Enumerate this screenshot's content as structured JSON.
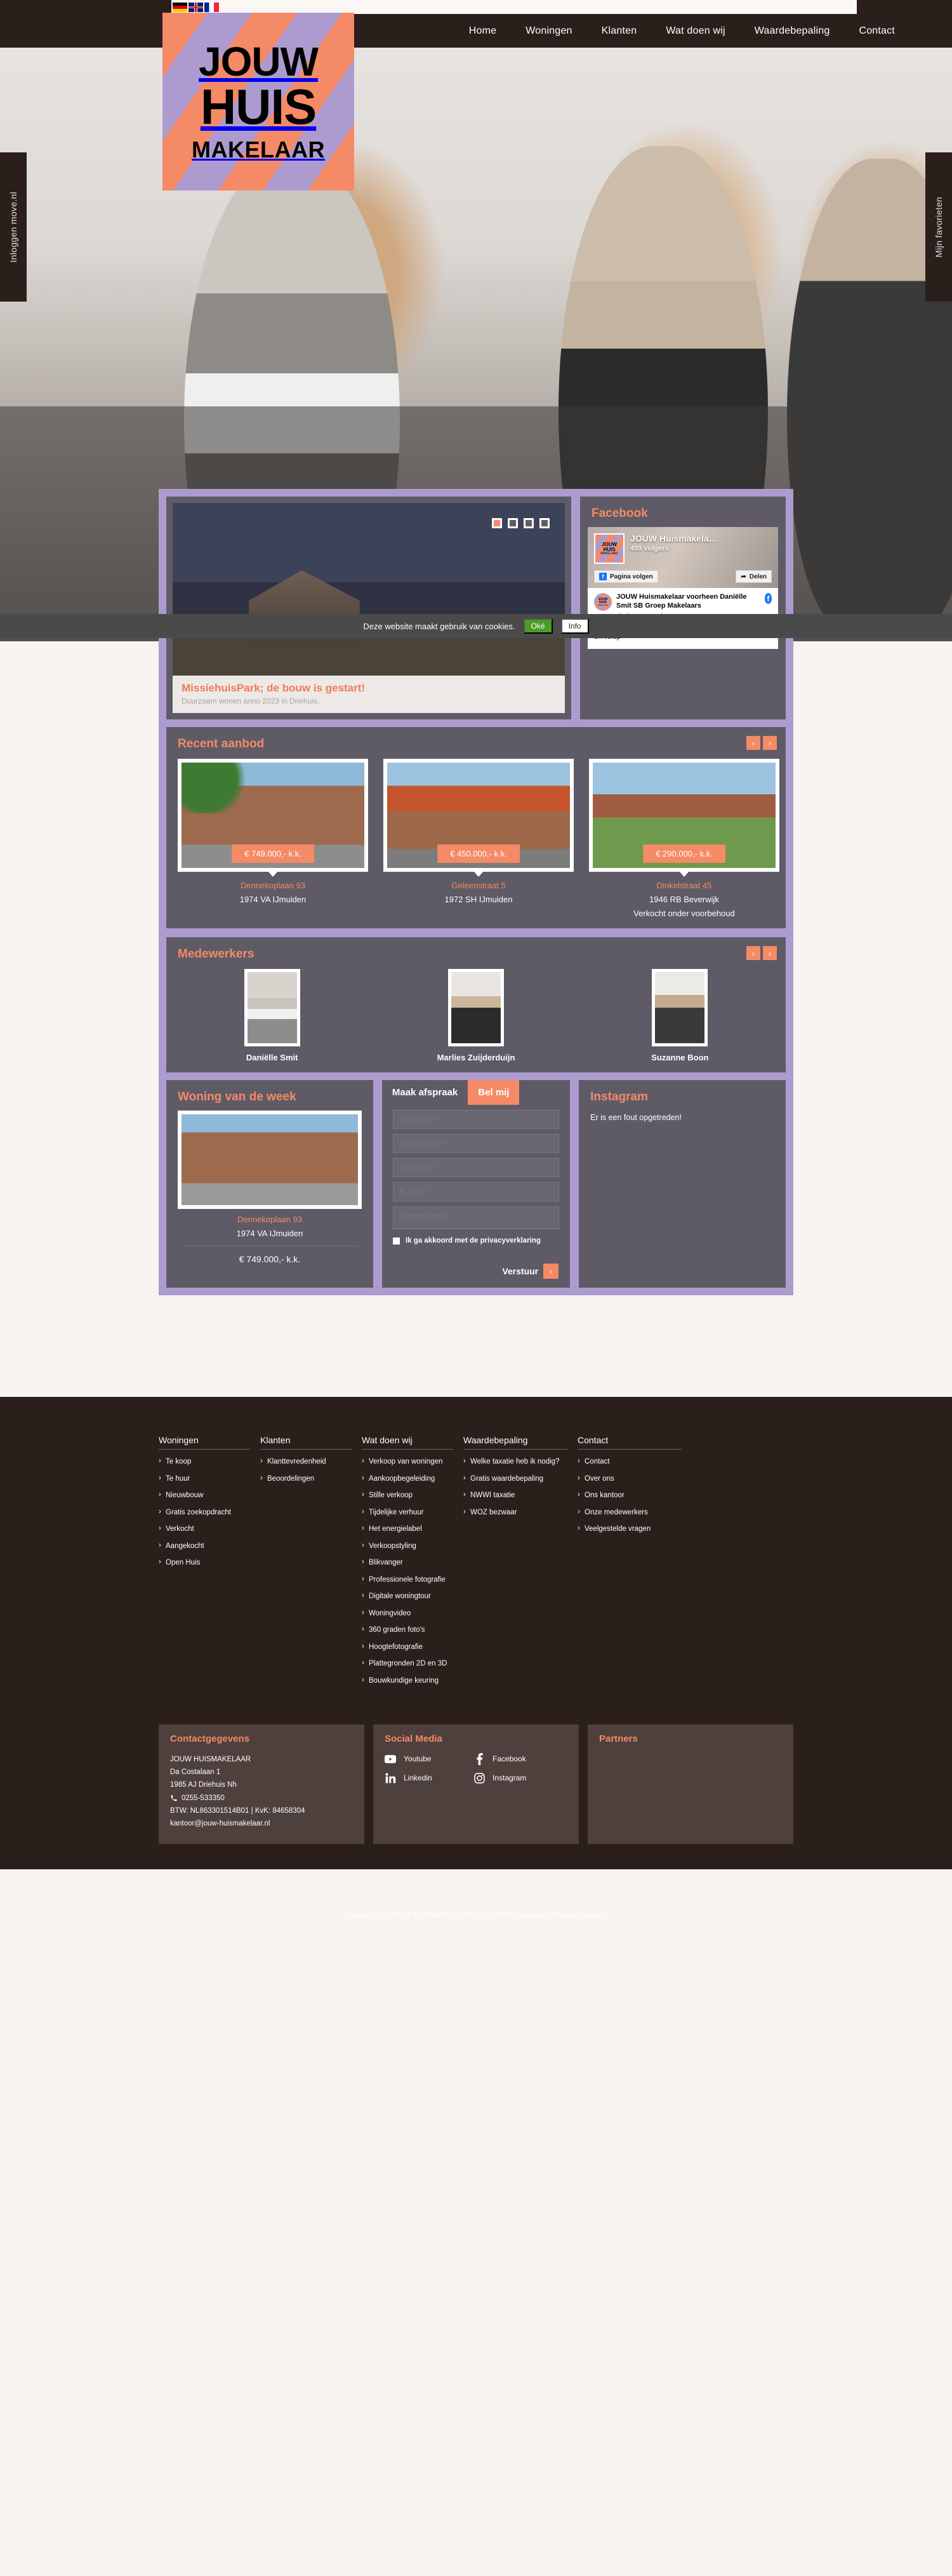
{
  "topbar": {
    "flags": [
      {
        "name": "flag-de",
        "label": "Deutsch"
      },
      {
        "name": "flag-gb",
        "label": "English"
      },
      {
        "name": "flag-fr",
        "label": "Français"
      }
    ],
    "nav": [
      {
        "label": "Home"
      },
      {
        "label": "Woningen"
      },
      {
        "label": "Klanten"
      },
      {
        "label": "Wat doen wij"
      },
      {
        "label": "Waardebepaling"
      },
      {
        "label": "Contact"
      }
    ]
  },
  "logo": {
    "line1": "JOUW",
    "line2": "HUIS",
    "line3": "MAKELAAR",
    "colors": {
      "orange": "#f58a66",
      "purple": "#ad9bd0"
    }
  },
  "side_tabs": {
    "left": "Inloggen move.nl",
    "right": "Mijn favorieten"
  },
  "cookie": {
    "message": "Deze website maakt gebruik van cookies.",
    "accept": "Oké",
    "info": "Info"
  },
  "slider": {
    "title": "MissiehuisPark; de bouw is gestart!",
    "subtitle": "Duurzaam wonen anno 2023 in Driehuis.",
    "dots": 4,
    "active_dot": 0
  },
  "facebook": {
    "panel_title": "Facebook",
    "page_name": "JOUW Huismakela…",
    "followers": "459 volgers",
    "avatar": {
      "l1": "JOUW",
      "l2": "HUIS",
      "l3": "MAKELAAR"
    },
    "follow_button": "Pagina volgen",
    "share_button": "Delen",
    "post": {
      "author": "JOUW Huismakelaar voorheen Daniëlle Smit SB Groep Makelaars",
      "time": "afgelopen woensdag",
      "body": "Royale, instapklare woning met een moderne uitstraling en volop"
    }
  },
  "recent": {
    "title": "Recent aanbod",
    "prev": "‹",
    "next": "›",
    "items": [
      {
        "price": "€ 749.000,- k.k.",
        "street": "Dennekoplaan 93",
        "city": "1974 VA IJmuiden",
        "status": ""
      },
      {
        "price": "€ 450.000,- k.k.",
        "street": "Geleenstraat 5",
        "city": "1972 SH IJmuiden",
        "status": ""
      },
      {
        "price": "€ 290.000,- k.k.",
        "street": "Dinkelstraat 45",
        "city": "1946 RB Beverwijk",
        "status": "Verkocht onder voorbehoud"
      }
    ]
  },
  "employees": {
    "title": "Medewerkers",
    "prev": "‹",
    "next": "›",
    "items": [
      {
        "name": "Daniëlle Smit"
      },
      {
        "name": "Marlies Zuijderduijn"
      },
      {
        "name": "Suzanne Boon"
      }
    ]
  },
  "week_house": {
    "title": "Woning van de week",
    "street": "Dennekoplaan 93",
    "city": "1974 VA IJmuiden",
    "price": "€ 749.000,- k.k."
  },
  "appointment": {
    "tab_active": "Maak afspraak",
    "tab_inactive": "Bel mij",
    "fields": [
      {
        "name": "voornaam",
        "placeholder": "Voornaam *",
        "value": ""
      },
      {
        "name": "achternaam",
        "placeholder": "Achternaam *",
        "value": ""
      },
      {
        "name": "telefoon",
        "placeholder": "Telefoon *",
        "value": ""
      },
      {
        "name": "email",
        "placeholder": "E-mail *",
        "value": ""
      }
    ],
    "textarea": {
      "placeholder": "Opmerkingen",
      "value": ""
    },
    "privacy_label": "Ik ga akkoord met de privacyverklaring",
    "submit_label": "Verstuur",
    "submit_icon": "›"
  },
  "instagram": {
    "title": "Instagram",
    "error": "Er is een fout opgetreden!"
  },
  "footer": {
    "columns": [
      {
        "title": "Woningen",
        "links": [
          "Te koop",
          "Te huur",
          "Nieuwbouw",
          "Gratis zoekopdracht",
          "Verkocht",
          "Aangekocht",
          "Open Huis"
        ]
      },
      {
        "title": "Klanten",
        "links": [
          "Klanttevredenheid",
          "Beoordelingen"
        ]
      },
      {
        "title": "Wat doen wij",
        "links": [
          "Verkoop van woningen",
          "Aankoopbegeleiding",
          "Stille verkoop",
          "Tijdelijke verhuur",
          "Het energielabel",
          "Verkoopstyling",
          "Blikvanger",
          "Professionele fotografie",
          "Digitale woningtour",
          "Woningvideo",
          "360 graden foto's",
          "Hoogtefotografie",
          "Plattegronden 2D en 3D",
          "Bouwkundige keuring"
        ]
      },
      {
        "title": "Waardebepaling",
        "links": [
          "Welke taxatie heb ik nodig?",
          "Gratis waardebepaling",
          "NWWI taxatie",
          "WOZ bezwaar"
        ]
      },
      {
        "title": "Contact",
        "links": [
          "Contact",
          "Over ons",
          "Ons kantoor",
          "Onze medewerkers",
          "Veelgestelde vragen"
        ]
      }
    ],
    "contact": {
      "title": "Contactgegevens",
      "company": "JOUW HUISMAKELAAR",
      "street": "Da Costalaan 1",
      "city": "1985 AJ Driehuis Nh",
      "phone": "0255-533350",
      "tax": "BTW: NL863301514B01 | KvK: 84658304",
      "email": "kantoor@jouw-huismakelaar.nl"
    },
    "social": {
      "title": "Social Media",
      "items": [
        {
          "label": "Youtube",
          "icon": "youtube-icon"
        },
        {
          "label": "Facebook",
          "icon": "facebook-icon"
        },
        {
          "label": "Linkedin",
          "icon": "linkedin-icon"
        },
        {
          "label": "Instagram",
          "icon": "instagram-icon"
        }
      ]
    },
    "partners": {
      "title": "Partners"
    },
    "copyright": "Copyright © JOUW HUISMAKELAAR 2013-2025  Disclaimer Privacy Contact"
  }
}
